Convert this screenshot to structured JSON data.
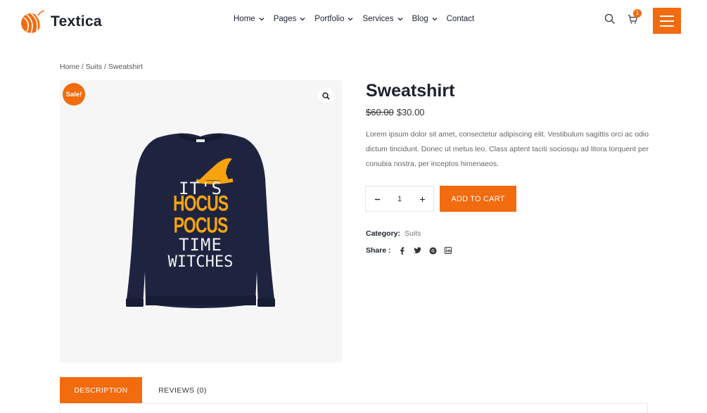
{
  "brand": {
    "name": "Textica",
    "accent": "#f26b0f"
  },
  "nav": {
    "items": [
      {
        "label": "Home",
        "has_dropdown": true
      },
      {
        "label": "Pages",
        "has_dropdown": true
      },
      {
        "label": "Portfolio",
        "has_dropdown": true
      },
      {
        "label": "Services",
        "has_dropdown": true
      },
      {
        "label": "Blog",
        "has_dropdown": true
      },
      {
        "label": "Contact",
        "has_dropdown": false
      }
    ],
    "cart_count": "1"
  },
  "breadcrumb": {
    "home": "Home",
    "sep": " / ",
    "category": "Suits",
    "current": "Sweatshirt"
  },
  "product": {
    "sale_badge": "Sale!",
    "title": "Sweatshirt",
    "old_price": "$60.00",
    "price": "$30.00",
    "description": "Lorem ipsum dolor sit amet, consectetur adipiscing elit. Vestibulum sagittis orci ac odio dictum tincidunt. Donec ut metus leo. Class aptent taciti sociosqu ad litora torquent per conubia nostra, per inceptos himenaeos.",
    "quantity": "1",
    "add_to_cart": "ADD TO CART",
    "category_label": "Category:",
    "category_value": "Suits",
    "share_label": "Share :",
    "shirt_text": [
      "IT'S",
      "HOCUS POCUS",
      "TIME",
      "WITCHES"
    ]
  },
  "tabs": [
    {
      "label": "DESCRIPTION",
      "active": true
    },
    {
      "label": "REVIEWS (0)",
      "active": false
    }
  ]
}
